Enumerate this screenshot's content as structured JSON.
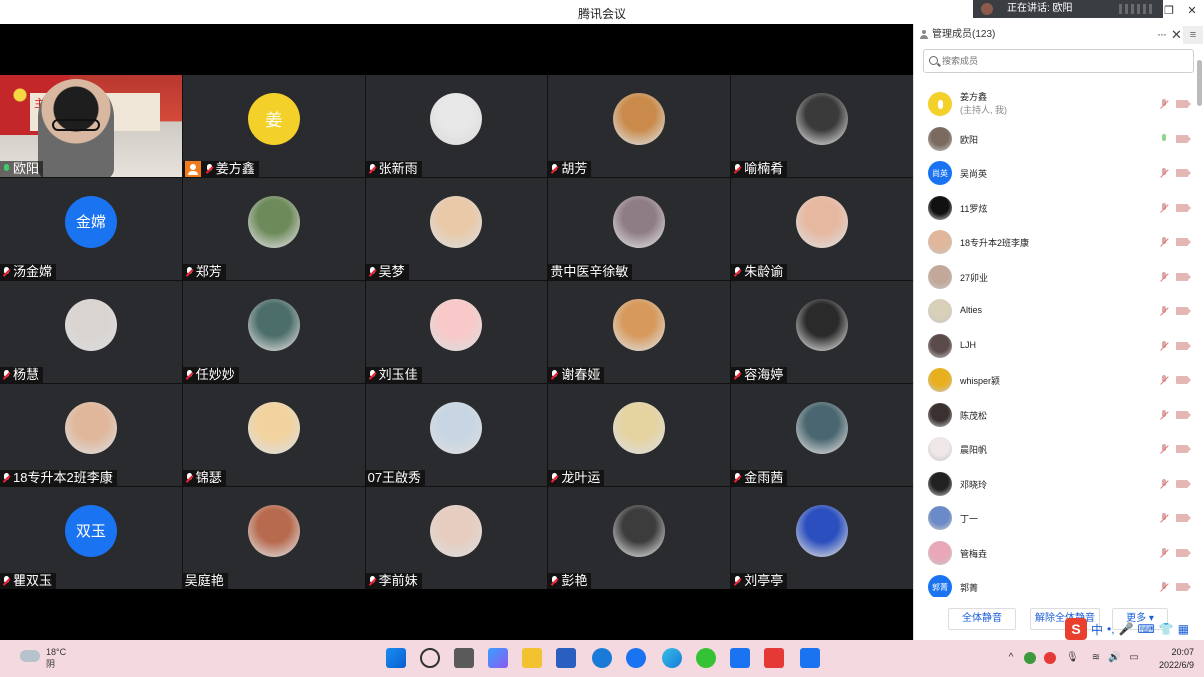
{
  "app": {
    "title": "腾讯会议"
  },
  "speaking": {
    "label": "正在讲话: 欧阳"
  },
  "participants": [
    {
      "name": "欧阳",
      "type": "video",
      "mic": "on",
      "video_banner": "主 护理学 党员"
    },
    {
      "name": "姜方鑫",
      "type": "text",
      "avatar_text": "姜",
      "avatar_style": "text-yellow",
      "mic": "off",
      "host": true
    },
    {
      "name": "张新雨",
      "type": "photo",
      "photo_color": "#e8e8e8",
      "mic": "off"
    },
    {
      "name": "胡芳",
      "type": "photo",
      "photo_color": "#c98a4a",
      "mic": "off"
    },
    {
      "name": "喻楠肴",
      "type": "photo",
      "photo_color": "#3a3a3a",
      "mic": "off"
    },
    {
      "name": "汤金嫦",
      "type": "text",
      "avatar_text": "金嫦",
      "avatar_style": "text-blue",
      "mic": "off"
    },
    {
      "name": "郑芳",
      "type": "photo",
      "photo_color": "#6d8a5a",
      "mic": "off"
    },
    {
      "name": "吴梦",
      "type": "photo",
      "photo_color": "#e9c9a8",
      "mic": "off"
    },
    {
      "name": "贵中医辛徐敏",
      "type": "photo",
      "photo_color": "#8f7d86",
      "mic": "none"
    },
    {
      "name": "朱龄谕",
      "type": "photo",
      "photo_color": "#e7b8a0",
      "mic": "off"
    },
    {
      "name": "杨慧",
      "type": "photo",
      "photo_color": "#d9d4d0",
      "mic": "off"
    },
    {
      "name": "任妙妙",
      "type": "photo",
      "photo_color": "#4c6e6a",
      "mic": "off"
    },
    {
      "name": "刘玉佳",
      "type": "photo",
      "photo_color": "#f9c9c9",
      "mic": "off"
    },
    {
      "name": "谢春娅",
      "type": "photo",
      "photo_color": "#d79a5c",
      "mic": "off"
    },
    {
      "name": "容海婷",
      "type": "photo",
      "photo_color": "#2a2a2a",
      "mic": "off"
    },
    {
      "name": "18专升本2班李康",
      "type": "photo",
      "photo_color": "#e0b79a",
      "mic": "off"
    },
    {
      "name": "锦瑟",
      "type": "photo",
      "photo_color": "#f2d3a0",
      "mic": "off"
    },
    {
      "name": "07王啟秀",
      "type": "photo",
      "photo_color": "#c8d6e4",
      "mic": "none"
    },
    {
      "name": "龙叶运",
      "type": "photo",
      "photo_color": "#e5d3a0",
      "mic": "off"
    },
    {
      "name": "金雨茜",
      "type": "photo",
      "photo_color": "#4a6670",
      "mic": "off"
    },
    {
      "name": "瞿双玉",
      "type": "text",
      "avatar_text": "双玉",
      "avatar_style": "text-blue",
      "mic": "off"
    },
    {
      "name": "吴庭艳",
      "type": "photo",
      "photo_color": "#b86a4e",
      "mic": "none"
    },
    {
      "name": "李前妹",
      "type": "photo",
      "photo_color": "#e6cdbf",
      "mic": "off"
    },
    {
      "name": "彭艳",
      "type": "photo",
      "photo_color": "#3c3c3c",
      "mic": "off"
    },
    {
      "name": "刘亭亭",
      "type": "photo",
      "photo_color": "#2b4fbf",
      "mic": "off"
    }
  ],
  "panel": {
    "title": "管理成员(123)",
    "search_placeholder": "搜索成员",
    "members": [
      {
        "name": "姜方鑫",
        "sub": "(主持人, 我)",
        "avatar_type": "icon",
        "avatar_color": "#f3d02a",
        "mic": "off"
      },
      {
        "name": "欧阳",
        "avatar_type": "photo",
        "avatar_color": "#7a6a60",
        "mic": "on"
      },
      {
        "name": "吴尚英",
        "avatar_type": "text",
        "avatar_text": "尚英",
        "avatar_color": "#1a73f0",
        "mic": "off"
      },
      {
        "name": "11罗炫",
        "avatar_type": "photo",
        "avatar_color": "#111111",
        "mic": "off"
      },
      {
        "name": "18专升本2班李康",
        "avatar_type": "photo",
        "avatar_color": "#e0b79a",
        "mic": "off"
      },
      {
        "name": "27卯业",
        "avatar_type": "photo",
        "avatar_color": "#c2a898",
        "mic": "off"
      },
      {
        "name": "Alties",
        "avatar_type": "photo",
        "avatar_color": "#d8d0b8",
        "mic": "off"
      },
      {
        "name": "LJH",
        "avatar_type": "photo",
        "avatar_color": "#5a4a4a",
        "mic": "off"
      },
      {
        "name": "whisper颍",
        "avatar_type": "photo",
        "avatar_color": "#e8b020",
        "mic": "off"
      },
      {
        "name": "陈茂松",
        "avatar_type": "photo",
        "avatar_color": "#3a3030",
        "mic": "off"
      },
      {
        "name": "晨阳帆",
        "avatar_type": "photo",
        "avatar_color": "#f0e8e8",
        "mic": "off"
      },
      {
        "name": "邓晓玲",
        "avatar_type": "photo",
        "avatar_color": "#222222",
        "mic": "off"
      },
      {
        "name": "丁一",
        "avatar_type": "photo",
        "avatar_color": "#6a8ac8",
        "mic": "off"
      },
      {
        "name": "管梅垚",
        "avatar_type": "photo",
        "avatar_color": "#e8a8b8",
        "mic": "off"
      },
      {
        "name": "郭菁",
        "avatar_type": "text",
        "avatar_text": "郭菁",
        "avatar_color": "#1a73f0",
        "mic": "off"
      }
    ],
    "buttons": {
      "mute_all": "全体静音",
      "unmute_all": "解除全体静音",
      "more": "更多"
    }
  },
  "ime": {
    "label": "中"
  },
  "taskbar": {
    "temp": "18°C",
    "weather": "阴",
    "time": "20:07",
    "date": "2022/6/9"
  }
}
